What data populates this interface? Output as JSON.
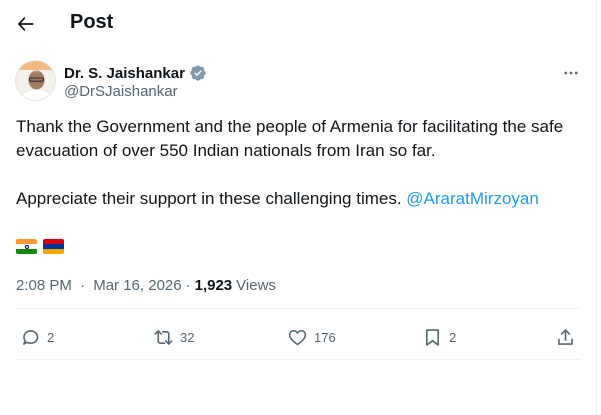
{
  "header": {
    "title": "Post",
    "back_icon": "arrow-left-icon"
  },
  "post": {
    "author": {
      "display_name": "Dr. S. Jaishankar",
      "handle": "@DrSJaishankar",
      "verified": true,
      "verified_color": "#829aab"
    },
    "text": {
      "line1": "Thank the Government and the people of Armenia for facilitating the safe evacuation of over 550 Indian nationals from Iran so far.",
      "line2": "Appreciate their support in these challenging times.",
      "mention": "@AraratMirzoyan"
    },
    "flags": [
      "india-flag",
      "armenia-flag"
    ],
    "meta": {
      "time": "2:08 PM",
      "date": "Mar 16, 2026",
      "separator": "·",
      "views_count": "1,923",
      "views_label": "Views"
    },
    "actions": {
      "replies": "2",
      "reposts": "32",
      "likes": "176",
      "bookmarks": "2"
    }
  },
  "colors": {
    "text_primary": "#0f1419",
    "text_secondary": "#536471",
    "link": "#1d9bf0",
    "divider": "#eff3f4"
  }
}
